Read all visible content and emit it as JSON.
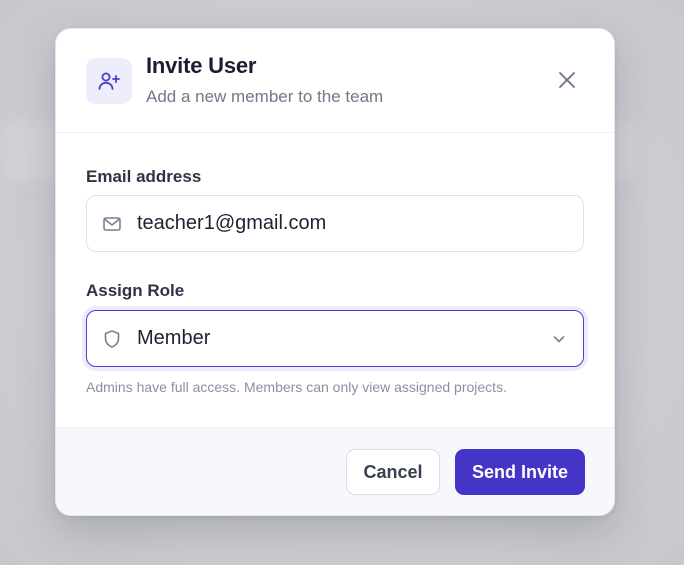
{
  "dialog": {
    "title": "Invite User",
    "subtitle": "Add a new member to the team",
    "header_icon": "user-plus-icon",
    "close_icon": "close-icon"
  },
  "form": {
    "email": {
      "label": "Email address",
      "value": "teacher1@gmail.com",
      "icon": "mail-icon"
    },
    "role": {
      "label": "Assign Role",
      "selected": "Member",
      "icon": "shield-icon",
      "dropdown_icon": "chevron-down-icon",
      "hint": "Admins have full access. Members can only view assigned projects."
    }
  },
  "footer": {
    "cancel_label": "Cancel",
    "submit_label": "Send Invite"
  },
  "colors": {
    "accent": "#4534c8",
    "accent_soft": "#eeedfb",
    "backdrop": "#cdced3",
    "text_primary": "#1b1e2e",
    "text_muted": "#727888"
  }
}
